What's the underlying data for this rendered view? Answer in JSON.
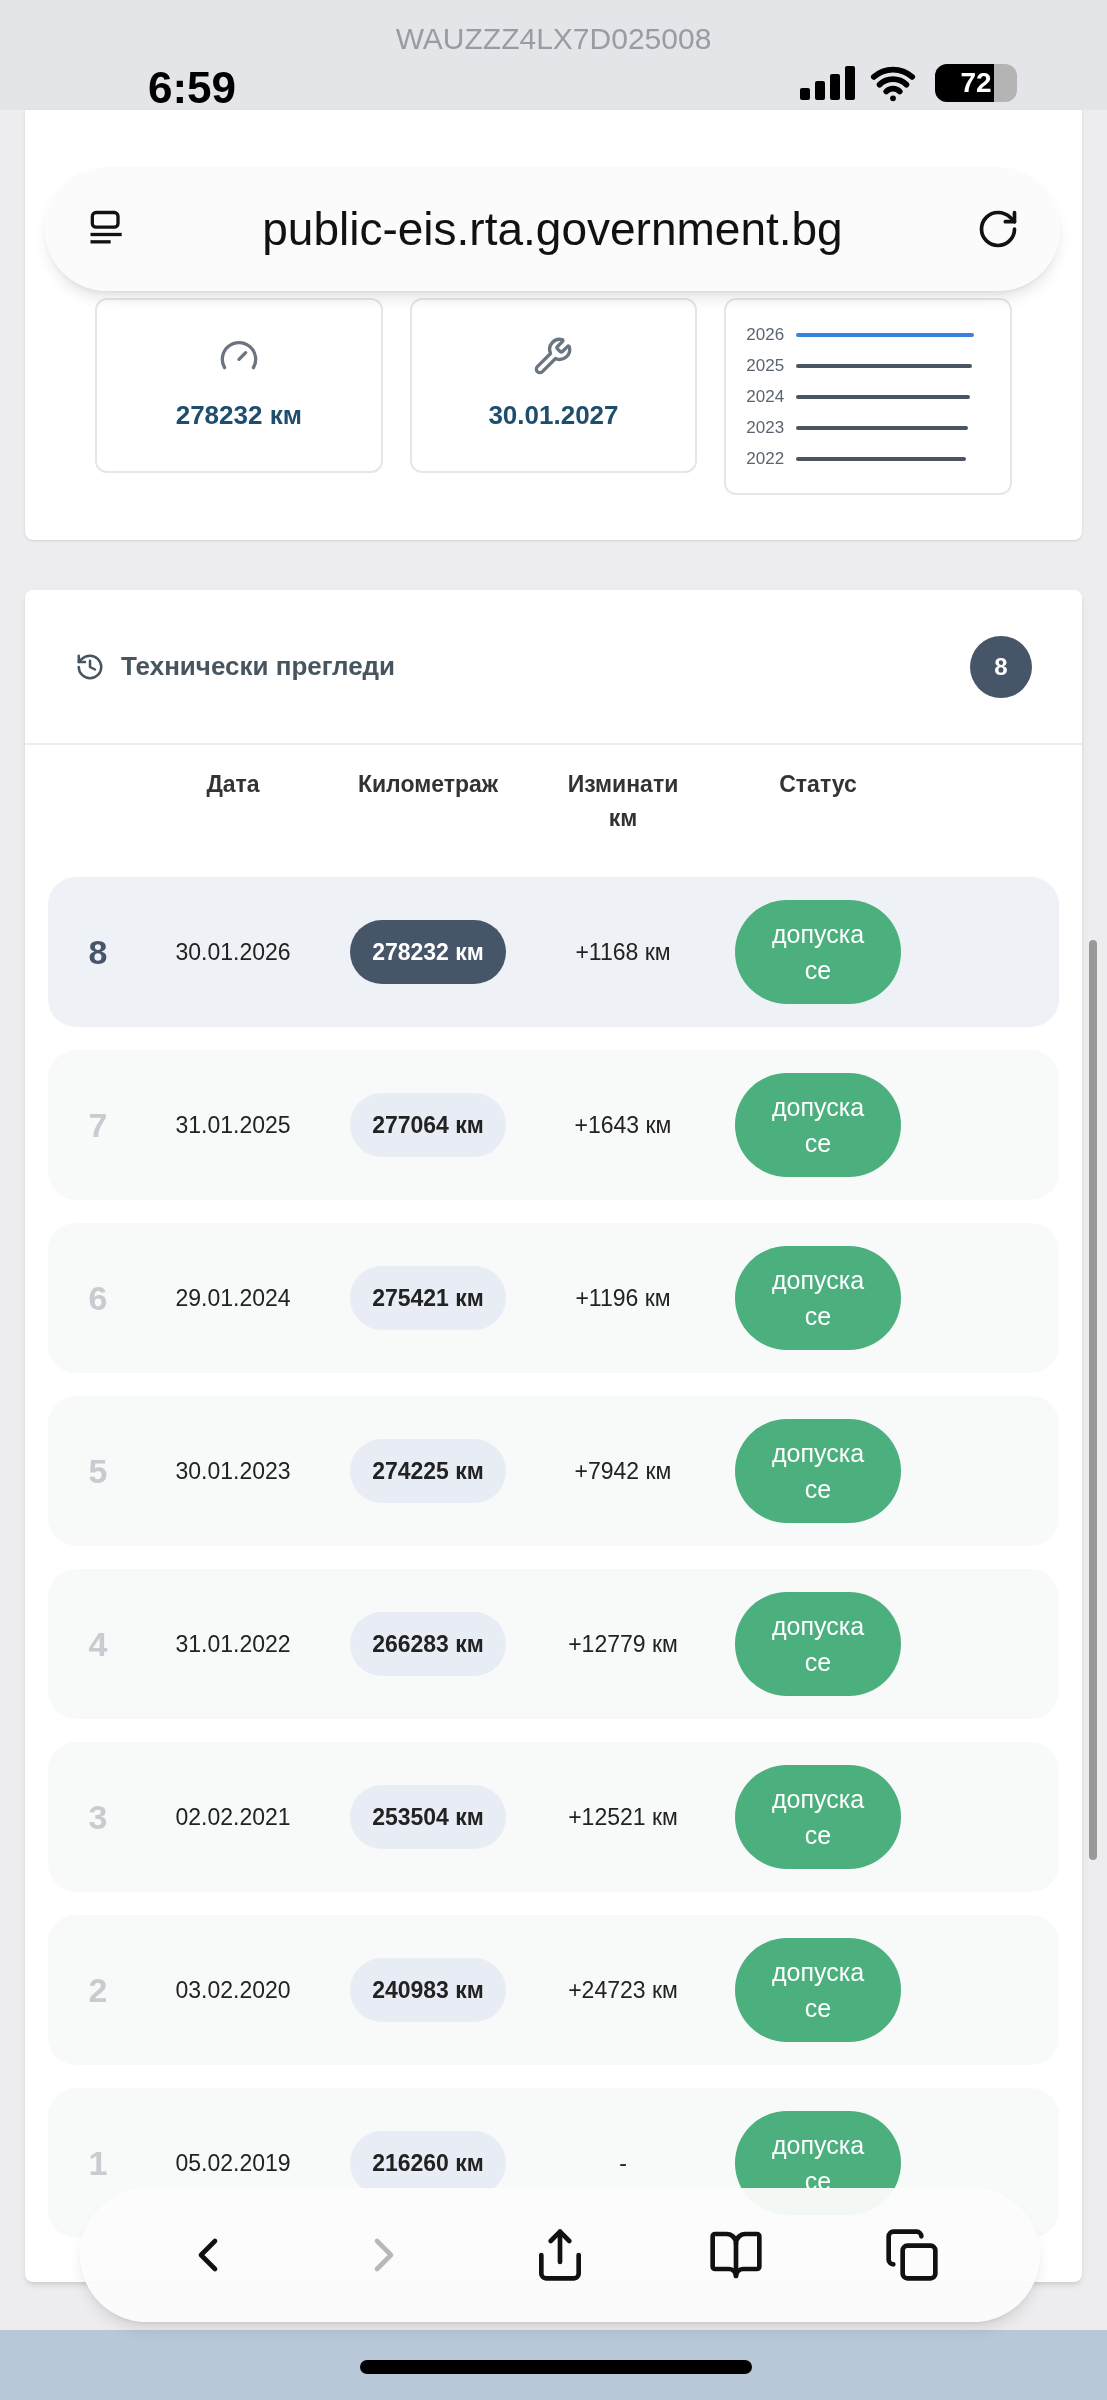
{
  "page_header": {
    "vin": "WAUZZZ4LX7D025008"
  },
  "status_bar": {
    "time": "6:59",
    "battery": "72"
  },
  "address_bar": {
    "url": "public-eis.rta.government.bg"
  },
  "summary": {
    "mileage": "278232 км",
    "next_inspection": "30.01.2027",
    "years": [
      {
        "label": "2026",
        "selected": true
      },
      {
        "label": "2025",
        "selected": false
      },
      {
        "label": "2024",
        "selected": false
      },
      {
        "label": "2023",
        "selected": false
      },
      {
        "label": "2022",
        "selected": false
      }
    ]
  },
  "inspections": {
    "title": "Технически прегледи",
    "count": "8",
    "columns": [
      "Дата",
      "Километраж",
      "Изминати км",
      "Статус"
    ],
    "rows": [
      {
        "number": "8",
        "date": "30.01.2026",
        "mileage": "278232 км",
        "distance": "+1168 км",
        "status": "допуска се",
        "selected": true
      },
      {
        "number": "7",
        "date": "31.01.2025",
        "mileage": "277064 км",
        "distance": "+1643 км",
        "status": "допуска се",
        "selected": false
      },
      {
        "number": "6",
        "date": "29.01.2024",
        "mileage": "275421 км",
        "distance": "+1196 км",
        "status": "допуска се",
        "selected": false
      },
      {
        "number": "5",
        "date": "30.01.2023",
        "mileage": "274225 км",
        "distance": "+7942 км",
        "status": "допуска се",
        "selected": false
      },
      {
        "number": "4",
        "date": "31.01.2022",
        "mileage": "266283 км",
        "distance": "+12779 км",
        "status": "допуска се",
        "selected": false
      },
      {
        "number": "3",
        "date": "02.02.2021",
        "mileage": "253504 км",
        "distance": "+12521 км",
        "status": "допуска се",
        "selected": false
      },
      {
        "number": "2",
        "date": "03.02.2020",
        "mileage": "240983 км",
        "distance": "+24723 км",
        "status": "допуска се",
        "selected": false
      },
      {
        "number": "1",
        "date": "05.02.2019",
        "mileage": "216260 км",
        "distance": "-",
        "status": "допуска се",
        "selected": false
      }
    ]
  },
  "toolbar": {
    "buttons": [
      {
        "kind": "back",
        "disabled": false
      },
      {
        "kind": "forward",
        "disabled": true
      },
      {
        "kind": "share",
        "disabled": false
      },
      {
        "kind": "bookmarks",
        "disabled": false
      },
      {
        "kind": "tabs",
        "disabled": false
      }
    ]
  }
}
